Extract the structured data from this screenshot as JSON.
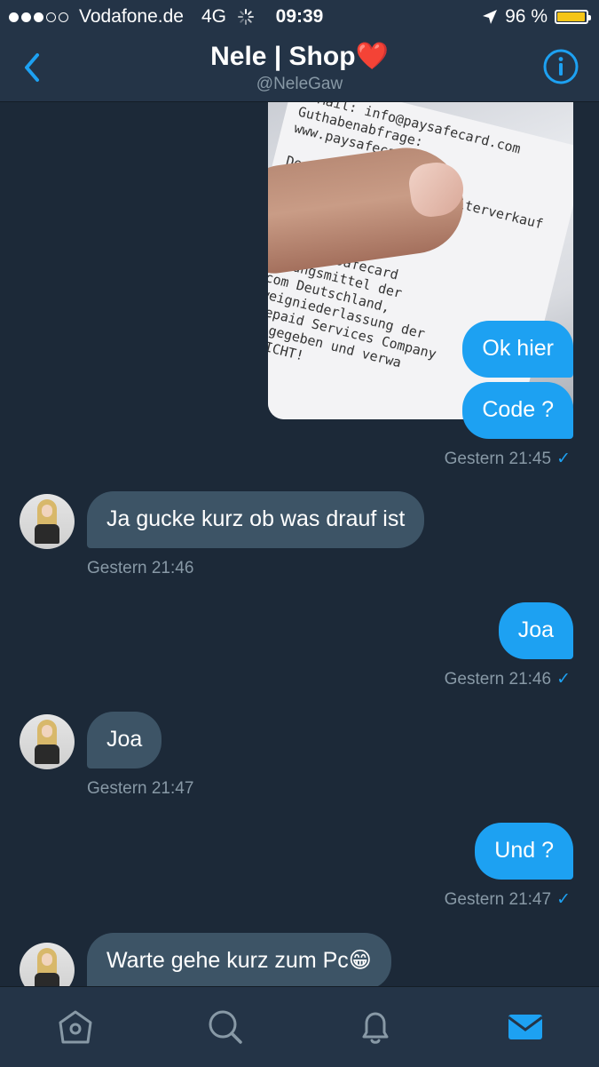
{
  "status_bar": {
    "carrier": "Vodafone.de",
    "network": "4G",
    "time": "09:39",
    "battery": "96 %",
    "battery_level": 0.96,
    "battery_color": "#f5c518"
  },
  "header": {
    "back_icon": "chevron-left-icon",
    "title": "Nele | Shop",
    "title_emoji": "❤️",
    "handle": "@NeleGaw",
    "info_icon": "info-icon"
  },
  "conversation": {
    "image_text": "E-Mail: info@paysafecard.com\nGuthabenabfrage:\nwww.paysafecard.com\n\nDer gewerbsmaessige Weiterverkauf\nist verboten. Es\nKartenbe\nin Ihrer\noder unter\n.com. Paysafecard\nZahlungsmittel der\n.com Deutschland,\nZweigniederlassung der\nPrepaid Services Company\nausgegeben und verwa\nGESICHT!",
    "messages": [
      {
        "dir": "out",
        "text": "Ok hier"
      },
      {
        "dir": "out",
        "text": "Code ?",
        "timestamp": "Gestern 21:45",
        "check": "✓"
      },
      {
        "dir": "in",
        "text": "Ja gucke kurz ob was drauf ist",
        "timestamp": "Gestern 21:46"
      },
      {
        "dir": "out",
        "text": "Joa",
        "timestamp": "Gestern 21:46",
        "check": "✓"
      },
      {
        "dir": "in",
        "text": "Joa",
        "timestamp": "Gestern 21:47"
      },
      {
        "dir": "out",
        "text": "Und ?",
        "timestamp": "Gestern 21:47",
        "check": "✓"
      },
      {
        "dir": "in",
        "text": "Warte gehe kurz zum Pc😁"
      }
    ]
  },
  "tab_bar": {
    "items": [
      {
        "icon": "home-icon",
        "active": false
      },
      {
        "icon": "search-icon",
        "active": false
      },
      {
        "icon": "bell-icon",
        "active": false
      },
      {
        "icon": "mail-icon",
        "active": true
      }
    ]
  },
  "colors": {
    "background": "#1c2938",
    "bar": "#243447",
    "outgoing_bubble": "#1da1f2",
    "incoming_bubble": "#3d5466",
    "secondary_text": "#8899a6",
    "accent": "#1da1f2"
  }
}
